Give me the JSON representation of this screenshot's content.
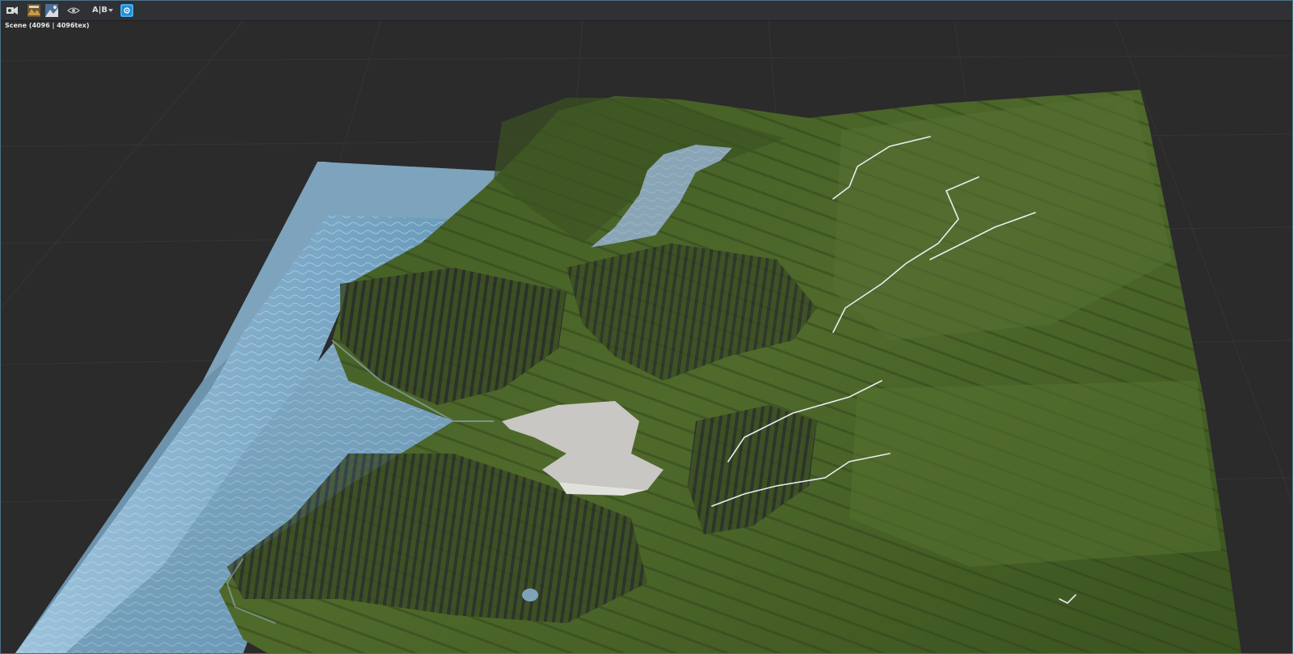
{
  "app": {
    "scene_label": "Scene (4096 | 4096tex)"
  },
  "toolbar": {
    "buttons": [
      {
        "name": "camera-move-icon"
      },
      {
        "name": "render-preview-icon"
      },
      {
        "name": "texture-preview-icon"
      },
      {
        "name": "eye-icon"
      },
      {
        "name": "ab-compare-dropdown",
        "label": "A|B"
      },
      {
        "name": "sync-view-icon"
      }
    ],
    "ab_label": "A|B"
  },
  "colors": {
    "background": "#2b2b2b",
    "toolbar": "#2f3134",
    "accent": "#1a8fd6",
    "water": "#6f9bb8",
    "grass": "#4a6328",
    "rock": "#2c2e30",
    "snow": "#c9c9c6"
  }
}
